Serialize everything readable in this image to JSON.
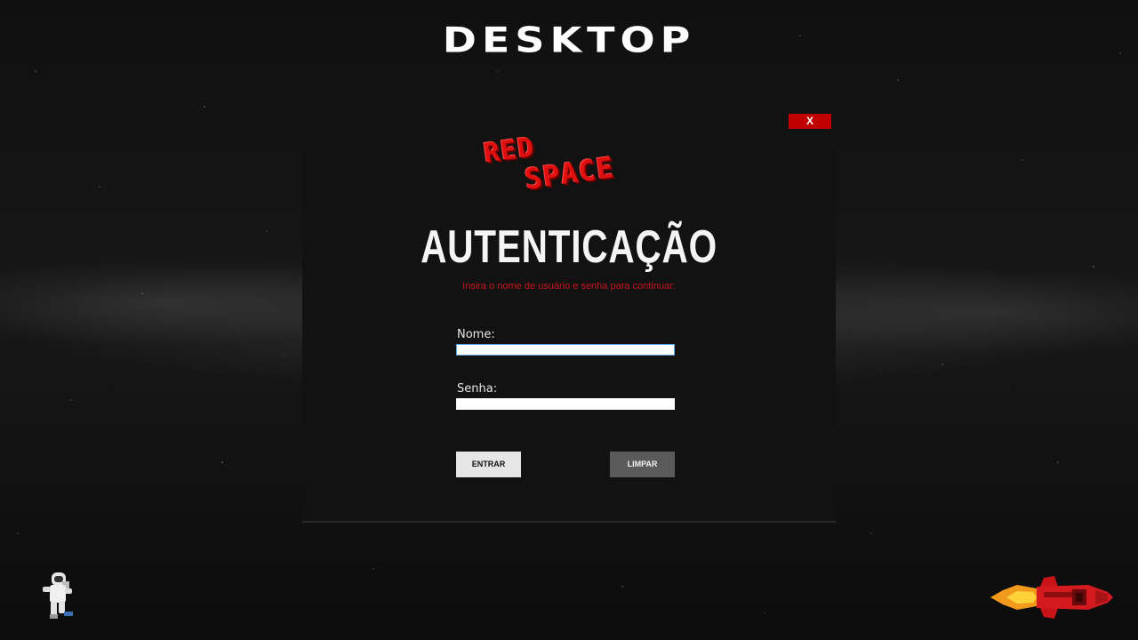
{
  "desktop": {
    "title": "DESKTOP"
  },
  "window": {
    "close_label": "X",
    "logo": {
      "line1": "RED",
      "line2": "SPACE"
    },
    "heading": "AUTENTICAÇÃO",
    "subtitle": "Insira o nome de usuário e senha para continuar:",
    "form": {
      "name_label": "Nome:",
      "name_value": "",
      "password_label": "Senha:",
      "password_value": ""
    },
    "buttons": {
      "enter_label": "ENTRAR",
      "clear_label": "LIMPAR"
    }
  },
  "decorations": {
    "left_sprite": "astronaut-icon",
    "right_sprite": "rocket-icon"
  },
  "colors": {
    "accent_red": "#c8161c",
    "close_red": "#c00000",
    "window_bg": "#121212"
  }
}
